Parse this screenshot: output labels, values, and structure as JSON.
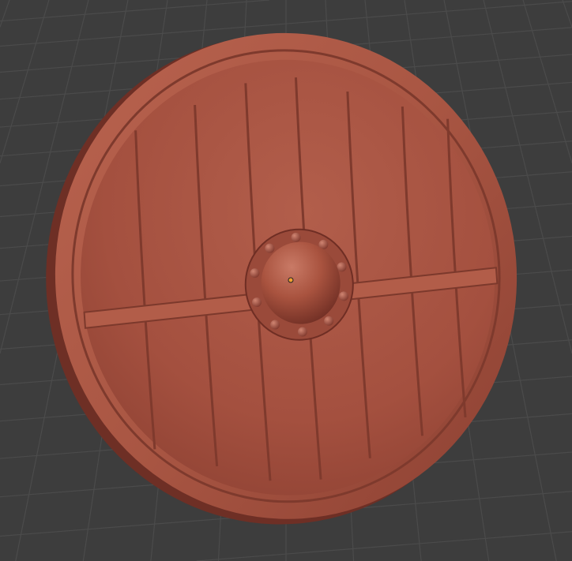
{
  "viewport": {
    "background_color": "#3d3d3d",
    "grid_color": "#4b4b4b",
    "object_color": "#a4503f",
    "object_shadow_color": "#6e2f25",
    "object_highlight_color": "#c8725f",
    "origin_marker_color": "#f0a030"
  }
}
